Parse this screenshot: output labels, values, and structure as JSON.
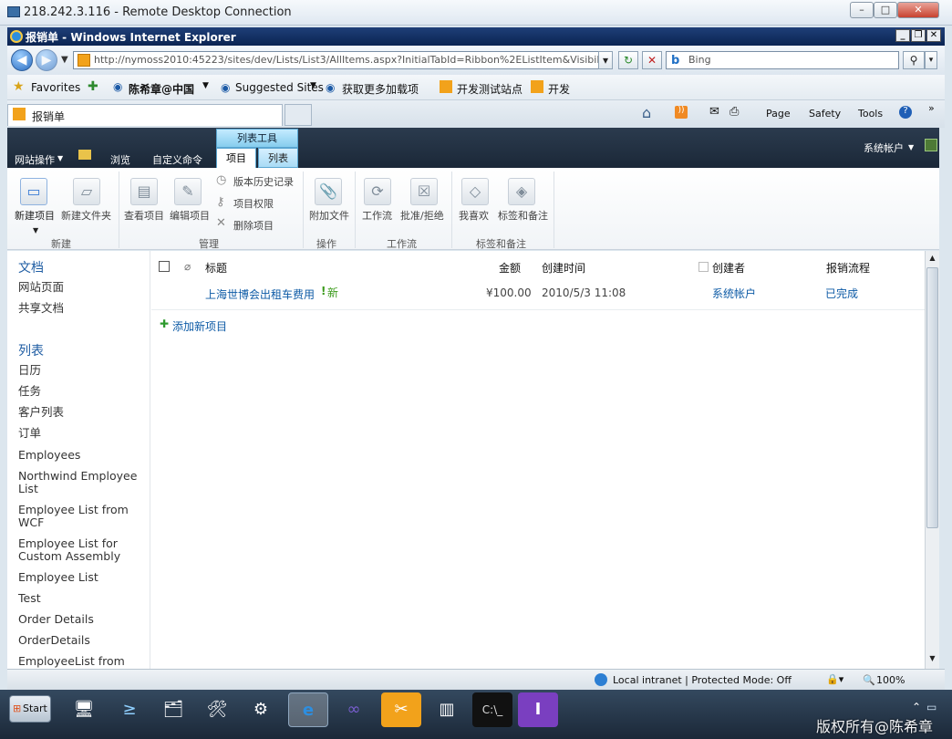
{
  "rdp": {
    "title": "218.242.3.116 - Remote Desktop Connection",
    "min": "–",
    "max": "□",
    "close": "✕"
  },
  "ie": {
    "title": "报销单 - Windows Internet Explorer",
    "address": "http://nymoss2010:45223/sites/dev/Lists/List3/AllItems.aspx?InitialTabId=Ribbon%2EListItem&VisibilityContext=",
    "search_placeholder": "Bing",
    "favorites": {
      "favorites_label": "Favorites",
      "items": [
        "陈希章@中国",
        "Suggested Sites",
        "获取更多加载项",
        "开发测试站点",
        "开发"
      ]
    },
    "tab": "报销单",
    "commands": [
      "Page",
      "Safety",
      "Tools"
    ]
  },
  "sp": {
    "site_actions": "网站操作",
    "browse": "浏览",
    "custom": "自定义命令",
    "context_tab": "列表工具",
    "tab_items": "项目",
    "tab_list": "列表",
    "user": "系统帐户"
  },
  "ribbon": {
    "new_item": "新建项目",
    "new_folder": "新建文件夹",
    "view_item": "查看项目",
    "edit_item": "编辑项目",
    "version_history": "版本历史记录",
    "item_permissions": "项目权限",
    "delete_item": "删除项目",
    "attach_file": "附加文件",
    "workflow": "工作流",
    "approve": "批准/拒绝",
    "like": "我喜欢",
    "tags": "标签和备注",
    "groups": [
      "新建",
      "管理",
      "操作",
      "工作流",
      "标签和备注"
    ]
  },
  "quicklaunch": {
    "docs_header": "文档",
    "docs": [
      "网站页面",
      "共享文档"
    ],
    "lists_header": "列表",
    "lists": [
      "日历",
      "任务",
      "客户列表",
      "订单",
      "Employees",
      "Northwind Employee List",
      "Employee List from WCF",
      "Employee List for Custom Assembly",
      "Employee List",
      "Test",
      "Order Details",
      "OrderDetails",
      "EmployeeList from"
    ]
  },
  "list": {
    "columns": [
      "标题",
      "金额",
      "创建时间",
      "创建者",
      "报销流程"
    ],
    "rows": [
      {
        "title": "上海世博会出租车费用",
        "new": "新",
        "amount": "¥100.00",
        "created": "2010/5/3 11:08",
        "author": "系统帐户",
        "flow": "已完成"
      }
    ],
    "add_new": "添加新项目"
  },
  "status": {
    "zone": "Local intranet | Protected Mode: Off",
    "zoom": "100%"
  },
  "taskbar": {
    "start": "Start",
    "watermark": "版权所有@陈希章"
  }
}
